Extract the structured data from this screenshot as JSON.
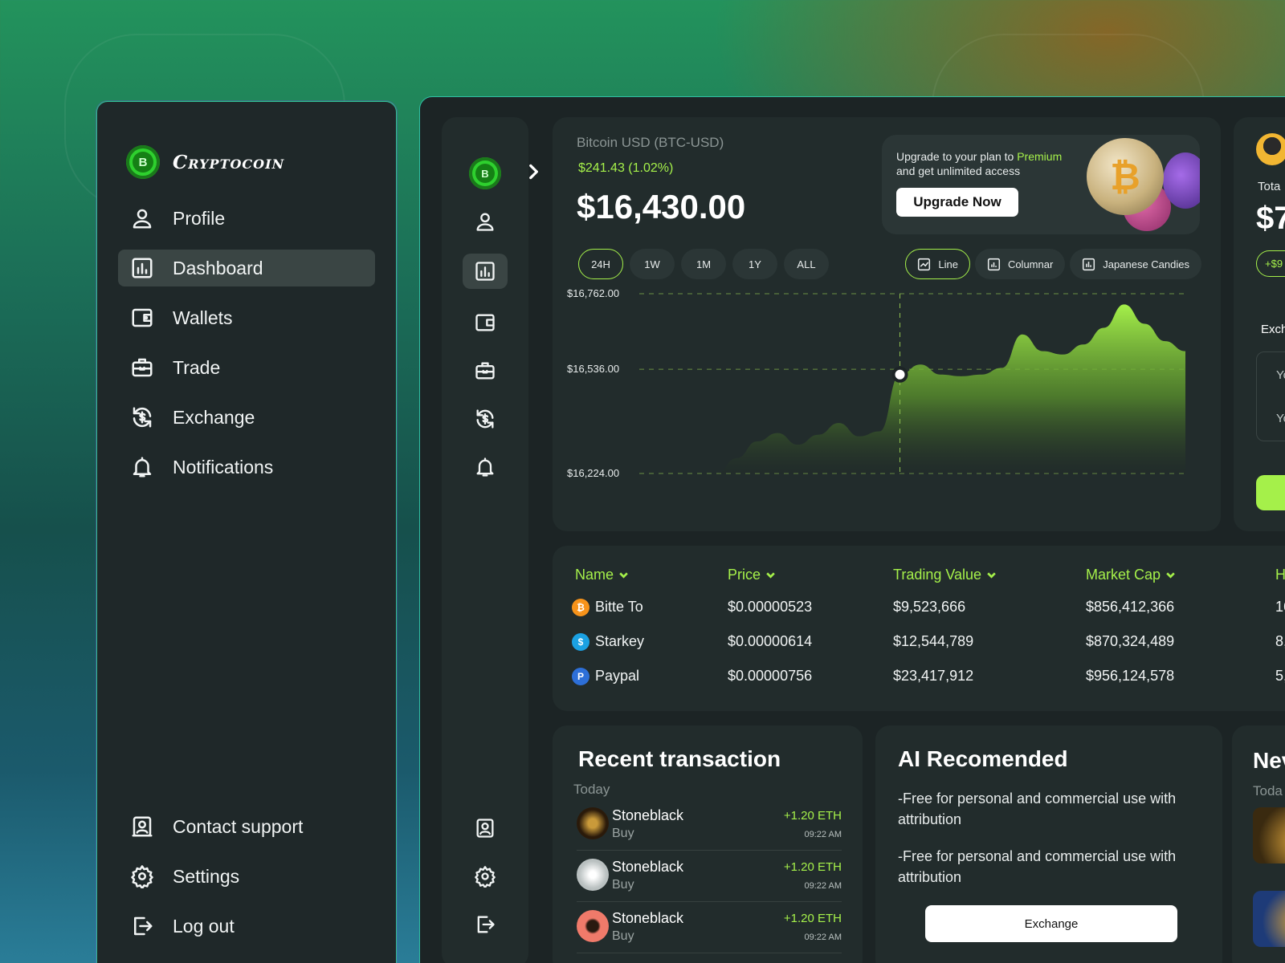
{
  "brand": {
    "name": "Cryptocoin",
    "logo_glyph": "B"
  },
  "sidebar": {
    "items": [
      {
        "label": "Profile",
        "icon": "user-icon"
      },
      {
        "label": "Dashboard",
        "icon": "chart-icon",
        "active": true
      },
      {
        "label": "Wallets",
        "icon": "wallet-icon"
      },
      {
        "label": "Trade",
        "icon": "briefcase-icon"
      },
      {
        "label": "Exchange",
        "icon": "exchange-icon"
      },
      {
        "label": "Notifications",
        "icon": "bell-icon"
      }
    ],
    "bottom_items": [
      {
        "label": "Contact support",
        "icon": "contact-icon"
      },
      {
        "label": "Settings",
        "icon": "gear-icon"
      },
      {
        "label": "Log out",
        "icon": "logout-icon"
      }
    ]
  },
  "ticker": {
    "pair": "Bitcoin USD (BTC-USD)",
    "change": "$241.43 (1.02%)",
    "price": "$16,430.00"
  },
  "upgrade": {
    "text_prefix": "Upgrade to your plan to ",
    "text_highlight": "Premium",
    "text_suffix": "and get unlimited access",
    "button": "Upgrade Now"
  },
  "timeframes": [
    {
      "label": "24H",
      "active": true
    },
    {
      "label": "1W"
    },
    {
      "label": "1M"
    },
    {
      "label": "1Y"
    },
    {
      "label": "ALL"
    }
  ],
  "chart_types": [
    {
      "label": "Line",
      "active": true
    },
    {
      "label": "Columnar"
    },
    {
      "label": "Japanese Candies"
    }
  ],
  "chart_data": {
    "type": "area",
    "y_ticks": [
      "$16,762.00",
      "$16,536.00",
      "$16,224.00"
    ],
    "ylim": [
      16224,
      16762
    ],
    "series": [
      {
        "values": [
          16224,
          16270,
          16320,
          16345,
          16310,
          16340,
          16375,
          16335,
          16350,
          16520,
          16550,
          16520,
          16515,
          16520,
          16540,
          16640,
          16590,
          16580,
          16610,
          16660,
          16730,
          16672,
          16620,
          16590
        ]
      }
    ],
    "highlight_index": 9,
    "color": "#a5f04a",
    "grid": true
  },
  "table": {
    "headers": [
      "Name",
      "Price",
      "Trading Value",
      "Market Cap",
      "H"
    ],
    "rows": [
      {
        "name": "Bitte To",
        "icon": "bitcoin-icon",
        "icon_color": "#f7931a",
        "glyph": "₿",
        "price": "$0.00000523",
        "trading_value": "$9,523,666",
        "market_cap": "$856,412,366",
        "extra": "16"
      },
      {
        "name": "Starkey",
        "icon": "dollar-coin-icon",
        "icon_color": "#1ba1e2",
        "glyph": "$",
        "price": "$0.00000614",
        "trading_value": "$12,544,789",
        "market_cap": "$870,324,489",
        "extra": "8,"
      },
      {
        "name": "Paypal",
        "icon": "paypal-icon",
        "icon_color": "#2d6fd8",
        "glyph": "P",
        "price": "$0.00000756",
        "trading_value": "$23,417,912",
        "market_cap": "$956,124,578",
        "extra": "5,"
      }
    ]
  },
  "recent": {
    "title": "Recent transaction",
    "day": "Today",
    "items": [
      {
        "name": "Stoneblack",
        "type": "Buy",
        "amount": "+1.20 ETH",
        "time": "09:22 AM"
      },
      {
        "name": "Stoneblack",
        "type": "Buy",
        "amount": "+1.20 ETH",
        "time": "09:22 AM"
      },
      {
        "name": "Stoneblack",
        "type": "Buy",
        "amount": "+1.20 ETH",
        "time": "09:22 AM"
      }
    ]
  },
  "ai": {
    "title": "AI Recomended",
    "lines": [
      "-Free for personal and commercial use with attribution",
      "-Free for personal and commercial use with attribution"
    ],
    "button": "Exchange"
  },
  "news": {
    "title": "Nev",
    "day": "Toda"
  },
  "right_panel": {
    "total_label": "Tota",
    "total_value": "$7",
    "delta": "+$9",
    "exchange_label": "Exch",
    "field1": "Yo",
    "field2": "Yo"
  }
}
